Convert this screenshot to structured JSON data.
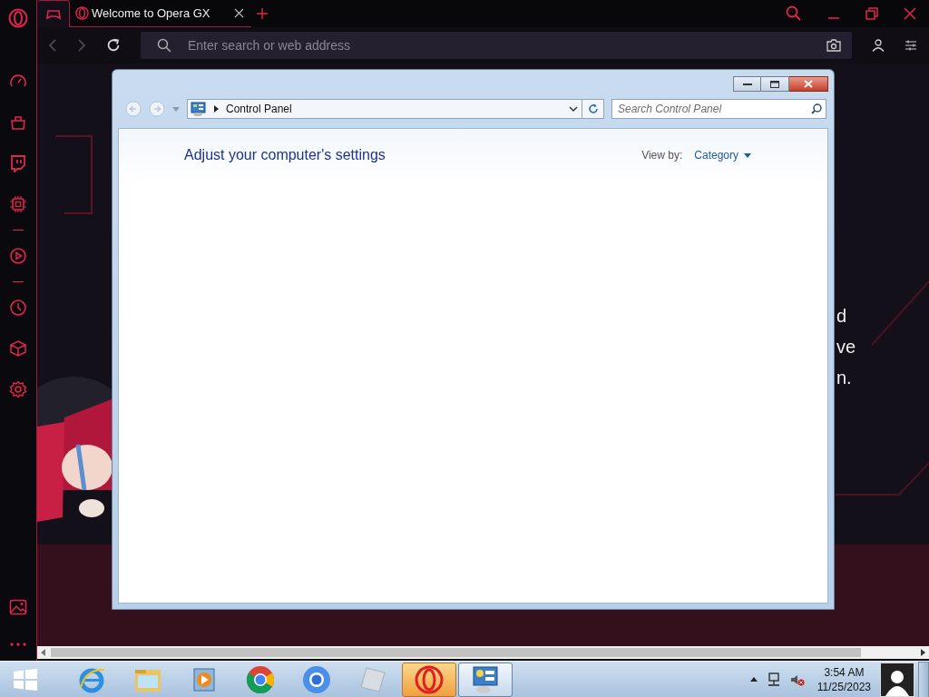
{
  "browser": {
    "tabs": [
      {
        "kind": "gx",
        "selected": true
      },
      {
        "kind": "page",
        "title": "Welcome to Opera GX",
        "selected": false
      }
    ],
    "address": {
      "placeholder": "Enter search or web address"
    },
    "page_text": [
      "d",
      "ve",
      "n."
    ]
  },
  "window": {
    "breadcrumb": "Control Panel",
    "search": {
      "placeholder": "Search Control Panel"
    },
    "heading": "Adjust your computer's settings",
    "view_by_label": "View by:",
    "view_by_value": "Category"
  },
  "taskbar": {
    "apps": [
      {
        "kind": "ie",
        "active": false
      },
      {
        "kind": "explorer",
        "active": false
      },
      {
        "kind": "media",
        "active": false
      },
      {
        "kind": "chrome",
        "active": false
      },
      {
        "kind": "chromium",
        "active": false
      },
      {
        "kind": "roblox",
        "active": false
      },
      {
        "kind": "opera",
        "active": true
      },
      {
        "kind": "control-panel",
        "active": true
      }
    ],
    "time": "3:54 AM",
    "date": "11/25/2023"
  }
}
